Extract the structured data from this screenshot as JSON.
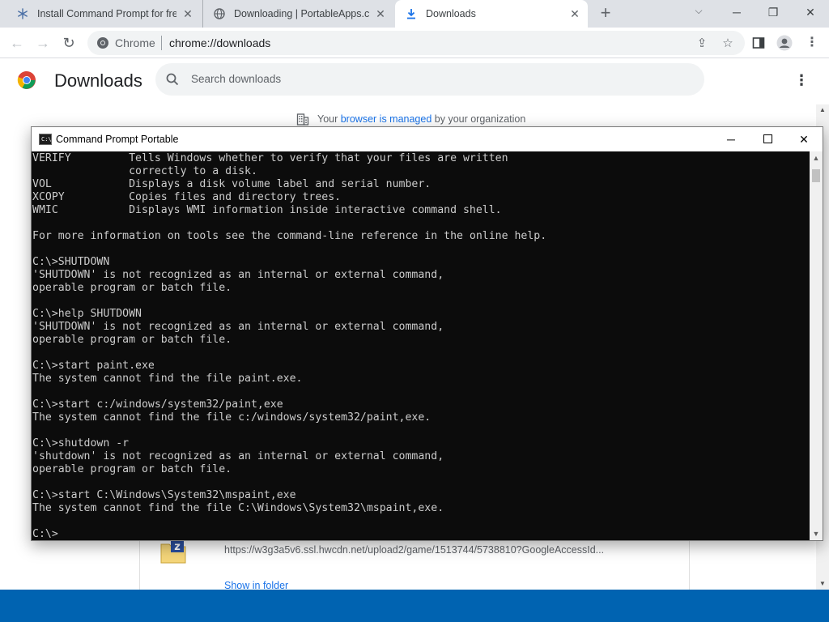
{
  "browser": {
    "tabs": [
      {
        "title": "Install Command Prompt for free",
        "icon": "gear-snowflake-icon",
        "active": false
      },
      {
        "title": "Downloading | PortableApps.com",
        "icon": "globe-icon",
        "active": false
      },
      {
        "title": "Downloads",
        "icon": "download-icon",
        "active": true
      }
    ],
    "omnibox": {
      "site_label": "Chrome",
      "url": "chrome://downloads"
    }
  },
  "downloads_page": {
    "title": "Downloads",
    "search_placeholder": "Search downloads",
    "managed_prefix": "Your ",
    "managed_link": "browser is managed",
    "managed_suffix": " by your organization",
    "item": {
      "url": "https://w3g3a5v6.ssl.hwcdn.net/upload2/game/1513744/5738810?GoogleAccessId...",
      "show_in_folder": "Show in folder"
    }
  },
  "cmd_window": {
    "title": "Command Prompt Portable",
    "lines": [
      "VERIFY         Tells Windows whether to verify that your files are written",
      "               correctly to a disk.",
      "VOL            Displays a disk volume label and serial number.",
      "XCOPY          Copies files and directory trees.",
      "WMIC           Displays WMI information inside interactive command shell.",
      "",
      "For more information on tools see the command-line reference in the online help.",
      "",
      "C:\\>SHUTDOWN",
      "'SHUTDOWN' is not recognized as an internal or external command,",
      "operable program or batch file.",
      "",
      "C:\\>help SHUTDOWN",
      "'SHUTDOWN' is not recognized as an internal or external command,",
      "operable program or batch file.",
      "",
      "C:\\>start paint.exe",
      "The system cannot find the file paint.exe.",
      "",
      "C:\\>start c:/windows/system32/paint,exe",
      "The system cannot find the file c:/windows/system32/paint,exe.",
      "",
      "C:\\>shutdown -r",
      "'shutdown' is not recognized as an internal or external command,",
      "operable program or batch file.",
      "",
      "C:\\>start C:\\Windows\\System32\\mspaint,exe",
      "The system cannot find the file C:\\Windows\\System32\\mspaint,exe.",
      "",
      "C:\\>"
    ]
  },
  "colors": {
    "tabstrip": "#dee1e6",
    "console_bg": "#0c0c0c",
    "console_text": "#cccccc",
    "taskbar": "#0063b1",
    "link": "#1a73e8"
  }
}
